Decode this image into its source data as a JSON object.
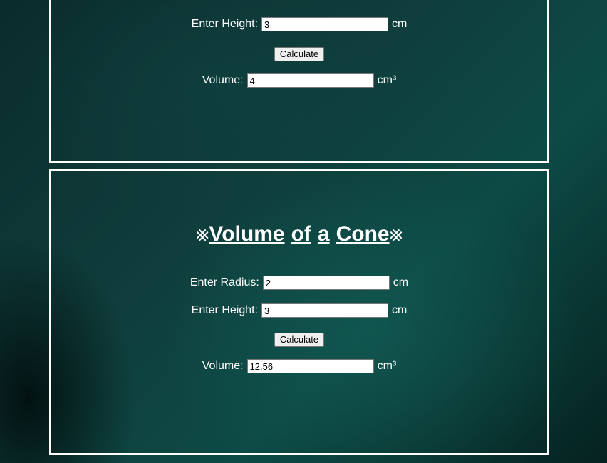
{
  "top_panel": {
    "height_label": "Enter Height:",
    "height_value": "3",
    "height_unit": "cm",
    "calculate_label": "Calculate",
    "volume_label": "Volume:",
    "volume_value": "4",
    "volume_unit": "cm³"
  },
  "cone_panel": {
    "title_deco_left": "⨳",
    "title_words": [
      "Volume",
      "of",
      "a",
      "Cone"
    ],
    "title_deco_right": "⨳",
    "radius_label": "Enter Radius:",
    "radius_value": "2",
    "radius_unit": "cm",
    "height_label": "Enter Height:",
    "height_value": "3",
    "height_unit": "cm",
    "calculate_label": "Calculate",
    "volume_label": "Volume:",
    "volume_value": "12.56",
    "volume_unit": "cm³"
  }
}
